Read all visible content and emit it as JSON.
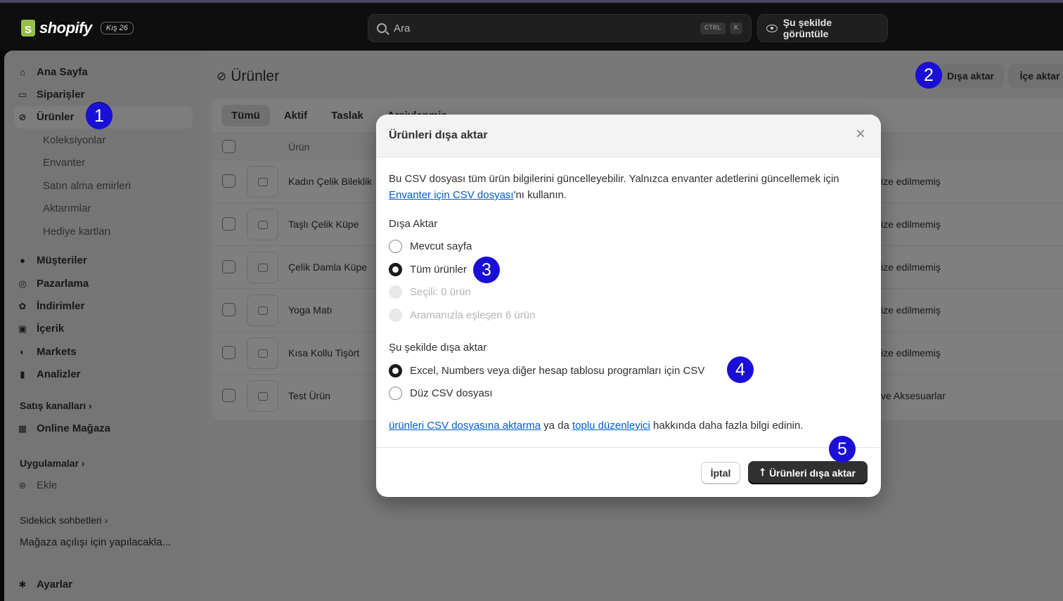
{
  "topbar": {
    "logo": "shopify",
    "edition": "Kış 26",
    "search_placeholder": "Ara",
    "kbd_ctrl": "CTRL",
    "kbd_k": "K",
    "view_as": "Şu şekilde görüntüle"
  },
  "sidebar": {
    "items": [
      {
        "label": "Ana Sayfa",
        "icon": "home-icon"
      },
      {
        "label": "Siparişler",
        "icon": "inbox-icon"
      },
      {
        "label": "Ürünler",
        "icon": "tag-icon"
      }
    ],
    "products_sub": [
      "Koleksiyonlar",
      "Envanter",
      "Satın alma emirleri",
      "Aktarımlar",
      "Hediye kartları"
    ],
    "items2": [
      {
        "label": "Müşteriler",
        "icon": "person-icon"
      },
      {
        "label": "Pazarlama",
        "icon": "target-icon"
      },
      {
        "label": "İndirimler",
        "icon": "discount-icon"
      },
      {
        "label": "İçerik",
        "icon": "content-icon"
      },
      {
        "label": "Markets",
        "icon": "globe-icon"
      },
      {
        "label": "Analizler",
        "icon": "chart-icon"
      }
    ],
    "sales_channels": "Satış kanalları ›",
    "online_store": "Online Mağaza",
    "apps": "Uygulamalar ›",
    "add": "Ekle",
    "sidekick": "Sidekick sohbetleri ›",
    "sidekick_item": "Mağaza açılışı için yapılacakla...",
    "settings": "Ayarlar"
  },
  "main": {
    "title": "Ürünler",
    "export_btn": "Dışa aktar",
    "import_btn": "İçe aktar",
    "tabs": [
      "Tümü",
      "Aktif",
      "Taslak",
      "Arşivlenmiş"
    ],
    "col_product": "Ürün",
    "rows": [
      {
        "name": "Kadın Çelik Bileklik",
        "cat": "ize edilmemiş"
      },
      {
        "name": "Taşlı Çelik Küpe",
        "cat": "ize edilmemiş"
      },
      {
        "name": "Çelik Damla Küpe",
        "cat": "ize edilmemiş"
      },
      {
        "name": "Yoga Matı",
        "cat": "ize edilmemiş"
      },
      {
        "name": "Kısa Kollu Tişört",
        "cat": "ize edilmemiş"
      },
      {
        "name": "Test Ürün",
        "cat": "ve Aksesuarlar"
      }
    ]
  },
  "modal": {
    "title": "Ürünleri dışa aktar",
    "desc_1": "Bu CSV dosyası tüm ürün bilgilerini güncelleyebilir. Yalnızca envanter adetlerini güncellemek için ",
    "desc_link": "Envanter için CSV dosyası",
    "desc_2": "'nı kullanın.",
    "export_label": "Dışa Aktar",
    "export_options": [
      {
        "label": "Mevcut sayfa",
        "state": "off"
      },
      {
        "label": "Tüm ürünler",
        "state": "on"
      },
      {
        "label": "Seçili: 0 ürün",
        "state": "disabled"
      },
      {
        "label": "Aramanızla eşleşen 6 ürün",
        "state": "disabled"
      }
    ],
    "format_label": "Şu şekilde dışa aktar",
    "format_options": [
      {
        "label": "Excel, Numbers veya diğer hesap tablosu programları için CSV",
        "state": "on"
      },
      {
        "label": "Düz CSV dosyası",
        "state": "off"
      }
    ],
    "footer_link1": "ürünleri CSV dosyasına aktarma",
    "footer_mid": " ya da ",
    "footer_link2": "toplu düzenleyici",
    "footer_end": " hakkında daha fazla bilgi edinin.",
    "cancel": "İptal",
    "submit": "Ürünleri dışa aktar"
  },
  "badges": [
    "1",
    "2",
    "3",
    "4",
    "5"
  ],
  "colors": {
    "badge": "#1a0fd6",
    "primary_button": "#303030",
    "link": "#005bd3"
  }
}
